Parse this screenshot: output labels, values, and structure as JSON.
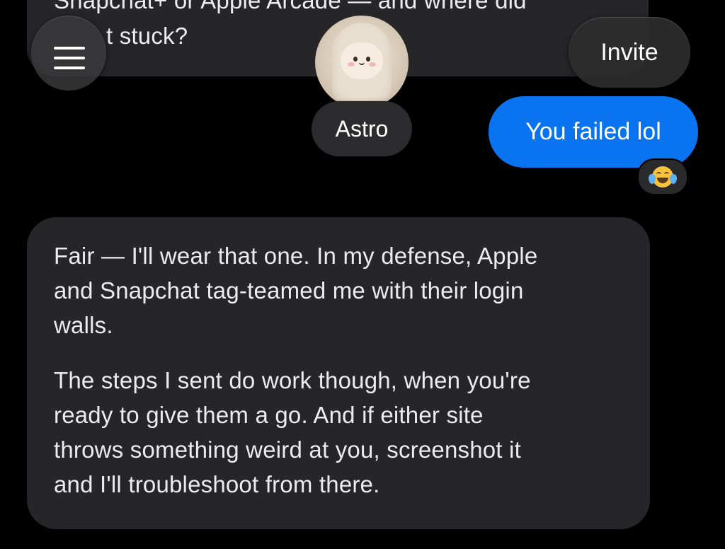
{
  "conversation": {
    "previous_message": {
      "line1": "Snapchat+ or Apple Arcade — and where did",
      "line2": "t stuck?"
    },
    "user_message": "You failed lol",
    "reaction_emoji": "face-with-tears-of-joy",
    "reply": {
      "paragraph1": [
        "Fair — I'll wear that one. In my defense, Apple",
        "and Snapchat tag-teamed me with their login",
        "walls."
      ],
      "paragraph2": [
        "The steps I sent do work though, when you're",
        "ready to give them a go. And if either site",
        "throws something weird at you, screenshot it",
        "and I'll troubleshoot from there."
      ]
    }
  },
  "header": {
    "assistant_name": "Astro",
    "invite_label": "Invite",
    "menu_icon": "hamburger-menu-icon"
  },
  "colors": {
    "background": "#000000",
    "assistant_bubble": "#262628",
    "user_bubble": "#0a74f0",
    "text": "#ececec"
  }
}
